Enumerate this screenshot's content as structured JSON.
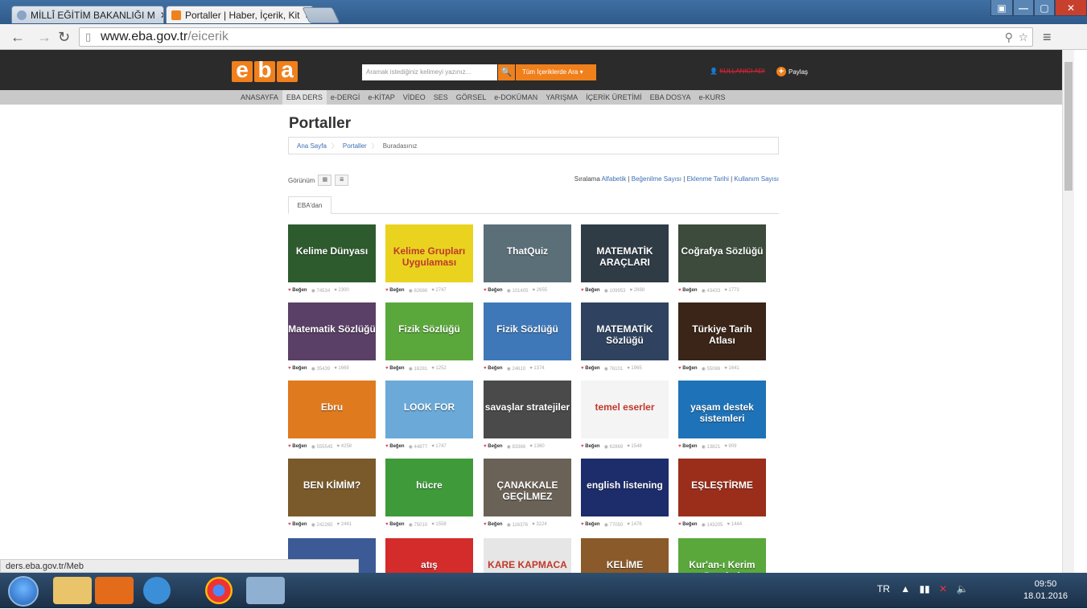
{
  "browser": {
    "tabs": [
      {
        "label": "MİLLÎ EĞİTİM BAKANLIĞI M",
        "active": false
      },
      {
        "label": "Portaller | Haber, İçerik, Kit",
        "active": true
      }
    ],
    "url_host": "www.eba.gov.tr",
    "url_path": "/eicerik",
    "status": "ders.eba.gov.tr/Meb"
  },
  "eba": {
    "logo": [
      "e",
      "b",
      "a"
    ],
    "search_placeholder": "Aramak istediğiniz kelimeyi yazınız...",
    "all_content_button": "Tüm İçeriklerde Ara",
    "user_name": "KULLANICI ADI",
    "share_label": "Paylaş",
    "menu": [
      "ANASAYFA",
      "EBA DERS",
      "e-DERGİ",
      "e-KİTAP",
      "VİDEO",
      "SES",
      "GÖRSEL",
      "e-DOKÜMAN",
      "YARIŞMA",
      "İÇERİK ÜRETİMİ",
      "EBA DOSYA",
      "e-KURS"
    ]
  },
  "page": {
    "title": "Portaller",
    "breadcrumb": [
      "Ana Sayfa",
      "Portaller",
      "Buradasınız"
    ],
    "view_label": "Görünüm",
    "sort_label": "Sıralama",
    "sort_options": [
      "Alfabetik",
      "Beğenilme Sayısı",
      "Eklenme Tarihi",
      "Kullanım Sayısı"
    ],
    "tab": "EBA'dan",
    "like_label": "Beğen"
  },
  "cards": [
    {
      "title": "Kelime Dünyası",
      "bg": "#2e5b2e",
      "views": "74534",
      "likes": "2300"
    },
    {
      "title": "Kelime Grupları Uygulaması",
      "bg": "#e9d31f",
      "views": "82686",
      "likes": "2747"
    },
    {
      "title": "ThatQuiz",
      "bg": "#5b6f78",
      "views": "101405",
      "likes": "2655"
    },
    {
      "title": "MATEMATİK ARAÇLARI",
      "bg": "#2f3b45",
      "views": "109953",
      "likes": "2888"
    },
    {
      "title": "Coğrafya Sözlüğü",
      "bg": "#3c4b3c",
      "views": "43433",
      "likes": "1773"
    },
    {
      "title": "Matematik Sözlüğü",
      "bg": "#5a3f66",
      "views": "35439",
      "likes": "1669"
    },
    {
      "title": "Fizik Sözlüğü",
      "bg": "#5aa83b",
      "views": "16281",
      "likes": "1252"
    },
    {
      "title": "Fizik Sözlüğü",
      "bg": "#3f78b8",
      "views": "24610",
      "likes": "1374"
    },
    {
      "title": "MATEMATİK Sözlüğü",
      "bg": "#2f4360",
      "views": "76101",
      "likes": "1965"
    },
    {
      "title": "Türkiye Tarih Atlası",
      "bg": "#3b2518",
      "views": "55086",
      "likes": "1641"
    },
    {
      "title": "Ebru",
      "bg": "#e07a1f",
      "views": "555545",
      "likes": "4258"
    },
    {
      "title": "LOOK FOR",
      "bg": "#6aa9d8",
      "views": "44877",
      "likes": "1747"
    },
    {
      "title": "savaşlar stratejiler",
      "bg": "#4a4a4a",
      "views": "83366",
      "likes": "1360"
    },
    {
      "title": "temel eserler",
      "bg": "#f4f4f4",
      "views": "62869",
      "likes": "1548"
    },
    {
      "title": "yaşam destek sistemleri",
      "bg": "#1e73b8",
      "views": "13821",
      "likes": "909"
    },
    {
      "title": "BEN KİMİM?",
      "bg": "#7a5a2a",
      "views": "242265",
      "likes": "2461"
    },
    {
      "title": "hücre",
      "bg": "#3f9b3a",
      "views": "75010",
      "likes": "1558"
    },
    {
      "title": "ÇANAKKALE GEÇİLMEZ",
      "bg": "#6b6257",
      "views": "116376",
      "likes": "3224"
    },
    {
      "title": "english listening",
      "bg": "#1d2d6b",
      "views": "77050",
      "likes": "1476"
    },
    {
      "title": "EŞLEŞTİRME",
      "bg": "#9b2e1a",
      "views": "143205",
      "likes": "1444"
    },
    {
      "title": "",
      "bg": "#3b5a96",
      "views": "",
      "likes": ""
    },
    {
      "title": "atış",
      "bg": "#d42b2b",
      "views": "",
      "likes": ""
    },
    {
      "title": "KARE KAPMACA",
      "bg": "#e6e6e6",
      "views": "",
      "likes": ""
    },
    {
      "title": "KELİME",
      "bg": "#8a5a2a",
      "views": "",
      "likes": ""
    },
    {
      "title": "Kur'an-ı Kerim Dersleri",
      "bg": "#5aa83b",
      "views": "",
      "likes": ""
    }
  ],
  "taskbar": {
    "lang": "TR",
    "time": "09:50",
    "date": "18.01.2016"
  }
}
